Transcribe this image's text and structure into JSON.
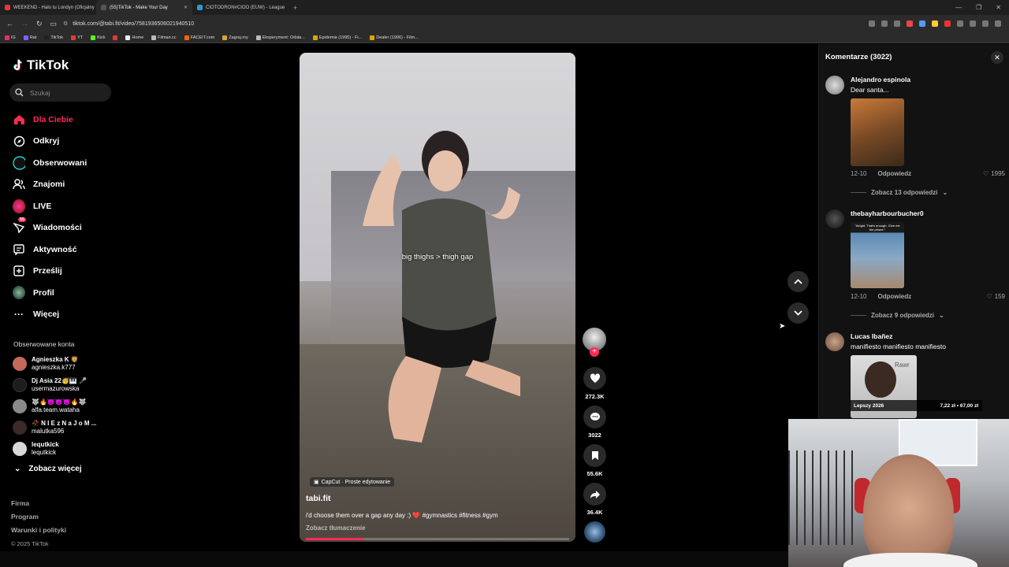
{
  "browser": {
    "tabs": [
      {
        "label": "WEEKEND - Halo tu Londyn (Oficjalny",
        "color": "#e53935"
      },
      {
        "label": "(55)TikTok - Make Your Day",
        "color": "#111111",
        "active": true
      },
      {
        "label": "CIOTODRON#CIOO (EUW) - League",
        "color": "#2a9bd8"
      }
    ],
    "url": "tiktok.com/@tabi.fit/video/7581936506021940510",
    "bookmarks": [
      "IG",
      "Rat",
      "TikTok",
      "YT",
      "Kick",
      "Home",
      "Filman.cc",
      "FACEIT.com",
      "Zagraj.my",
      "Eksperyment: Odsła...",
      "Epidemia (1995) - Fi...",
      "Dealer (1996) - Film..."
    ]
  },
  "sidebar": {
    "brand": "TikTok",
    "search_placeholder": "Szukaj",
    "nav": [
      {
        "label": "Dla Ciebie",
        "icon": "home-icon"
      },
      {
        "label": "Odkryj",
        "icon": "compass-icon"
      },
      {
        "label": "Obserwowani",
        "icon": "following-icon"
      },
      {
        "label": "Znajomi",
        "icon": "friends-icon"
      },
      {
        "label": "LIVE",
        "icon": "live-icon"
      },
      {
        "label": "Wiadomości",
        "icon": "messages-icon",
        "badge": "55"
      },
      {
        "label": "Aktywność",
        "icon": "activity-icon"
      },
      {
        "label": "Prześlij",
        "icon": "upload-icon"
      },
      {
        "label": "Profil",
        "icon": "profile-icon"
      },
      {
        "label": "Więcej",
        "icon": "more-icon"
      }
    ],
    "following_title": "Obserwowane konta",
    "following": [
      {
        "name": "Agnieszka K 🦁",
        "handle": "agnieszka.k777",
        "color": "#c46a5a"
      },
      {
        "name": "Dj Asia 22🥳🎹 🎤",
        "handle": "usermazurowska",
        "color": "#1d1d1d"
      },
      {
        "name": "🐺🔥😈😈😈🔥🐺",
        "handle": "alfa.team.wataha",
        "color": "#8a8a8a"
      },
      {
        "name": "🥀 N I E z N a J o M ...",
        "handle": "malutka596",
        "color": "#3a2a2a"
      },
      {
        "name": "lequtkick",
        "handle": "lequtkick",
        "color": "#d8d8d8"
      }
    ],
    "see_more": "Zobacz więcej",
    "footer": [
      "Firma",
      "Program",
      "Warunki i polityki"
    ],
    "copyright": "© 2025 TikTok"
  },
  "video": {
    "caption_overlay": "big thighs > thigh gap",
    "capcut": "CapCut · Proste edytowanie",
    "author": "tabi.fit",
    "description": "i'd choose them over a gap any day :) ❤️ #gymnastics #fitness #gym",
    "translate": "Zobacz tłumaczenie",
    "progress": 0.22,
    "likes": "272.3K",
    "comments": "3022",
    "saves": "55.6K",
    "shares": "36.4K"
  },
  "comments_panel": {
    "title": "Komentarze (3022)",
    "comments": [
      {
        "user": "Alejandro espinola",
        "text": "Dear santa...",
        "date": "12-10",
        "reply": "Odpowiedz",
        "likes": "1995",
        "view": "Zobacz 13 odpowiedzi"
      },
      {
        "user": "thebayharbourbucher0",
        "text": "",
        "image_text": "\"Alright. That's enough. Give me the phone.\"",
        "date": "12-10",
        "reply": "Odpowiedz",
        "likes": "159",
        "view": "Zobacz 9 odpowiedzi"
      },
      {
        "user": "Lucas Ibañez",
        "text": "manifiesto manifiesto manifiesto",
        "image_text": "Rawr"
      }
    ]
  },
  "overlay": {
    "left": "Lepszy 2026",
    "right": "7,22 zł • 67,00 zł"
  }
}
